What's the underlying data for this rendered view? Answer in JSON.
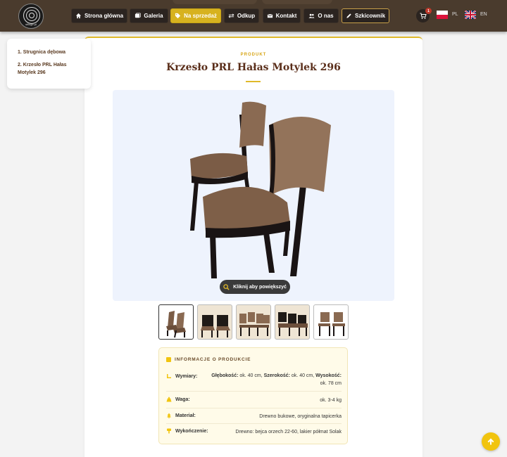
{
  "header": {
    "logo_text": "stilogo.pl",
    "nav": [
      {
        "id": "home",
        "label": "Strona główna",
        "icon": "home-icon"
      },
      {
        "id": "gallery",
        "label": "Galeria",
        "icon": "images-icon"
      },
      {
        "id": "sale",
        "label": "Na sprzedaż",
        "icon": "tag-icon",
        "active": true
      },
      {
        "id": "buyout",
        "label": "Odkup",
        "icon": "exchange-icon"
      },
      {
        "id": "contact",
        "label": "Kontakt",
        "icon": "envelope-icon"
      },
      {
        "id": "about",
        "label": "O nas",
        "icon": "users-icon"
      },
      {
        "id": "sketch",
        "label": "Szkicownik",
        "icon": "pencil-icon"
      }
    ],
    "cart_count": "1",
    "languages": [
      {
        "code": "PL",
        "label": "PL"
      },
      {
        "code": "EN",
        "label": "EN"
      }
    ]
  },
  "toc": {
    "items": [
      {
        "label": "1. Strugnica dębowa"
      },
      {
        "label": "2. Krzesło PRL Hałas Motylek 296"
      }
    ]
  },
  "product": {
    "eyebrow": "PRODUKT",
    "title": "Krzesło PRL Hałas Motylek 296",
    "zoom_label": "Kliknij aby powiększyć"
  },
  "info": {
    "heading": "INFORMACJE O PRODUKCIE",
    "rows": [
      {
        "label": "Wymiary:",
        "value_parts": [
          {
            "bold": "Głębokość:",
            "text": " ok. 40 cm, "
          },
          {
            "bold": "Szerokość:",
            "text": " ok. 40 cm, "
          },
          {
            "bold": "Wysokość:",
            "text": " ok. 78 cm"
          }
        ]
      },
      {
        "label": "Waga:",
        "value": "ok. 3-4 kg"
      },
      {
        "label": "Materiał:",
        "value": "Drewno bukowe, oryginalna tapicerka"
      },
      {
        "label": "Wykończenie:",
        "value": "Drewno: bejca orzech 22-60, lakier półmat Solak"
      }
    ]
  },
  "colors": {
    "header_bg": "#4a3b2d",
    "accent": "#e0b92a",
    "title": "#5a2e1a"
  }
}
